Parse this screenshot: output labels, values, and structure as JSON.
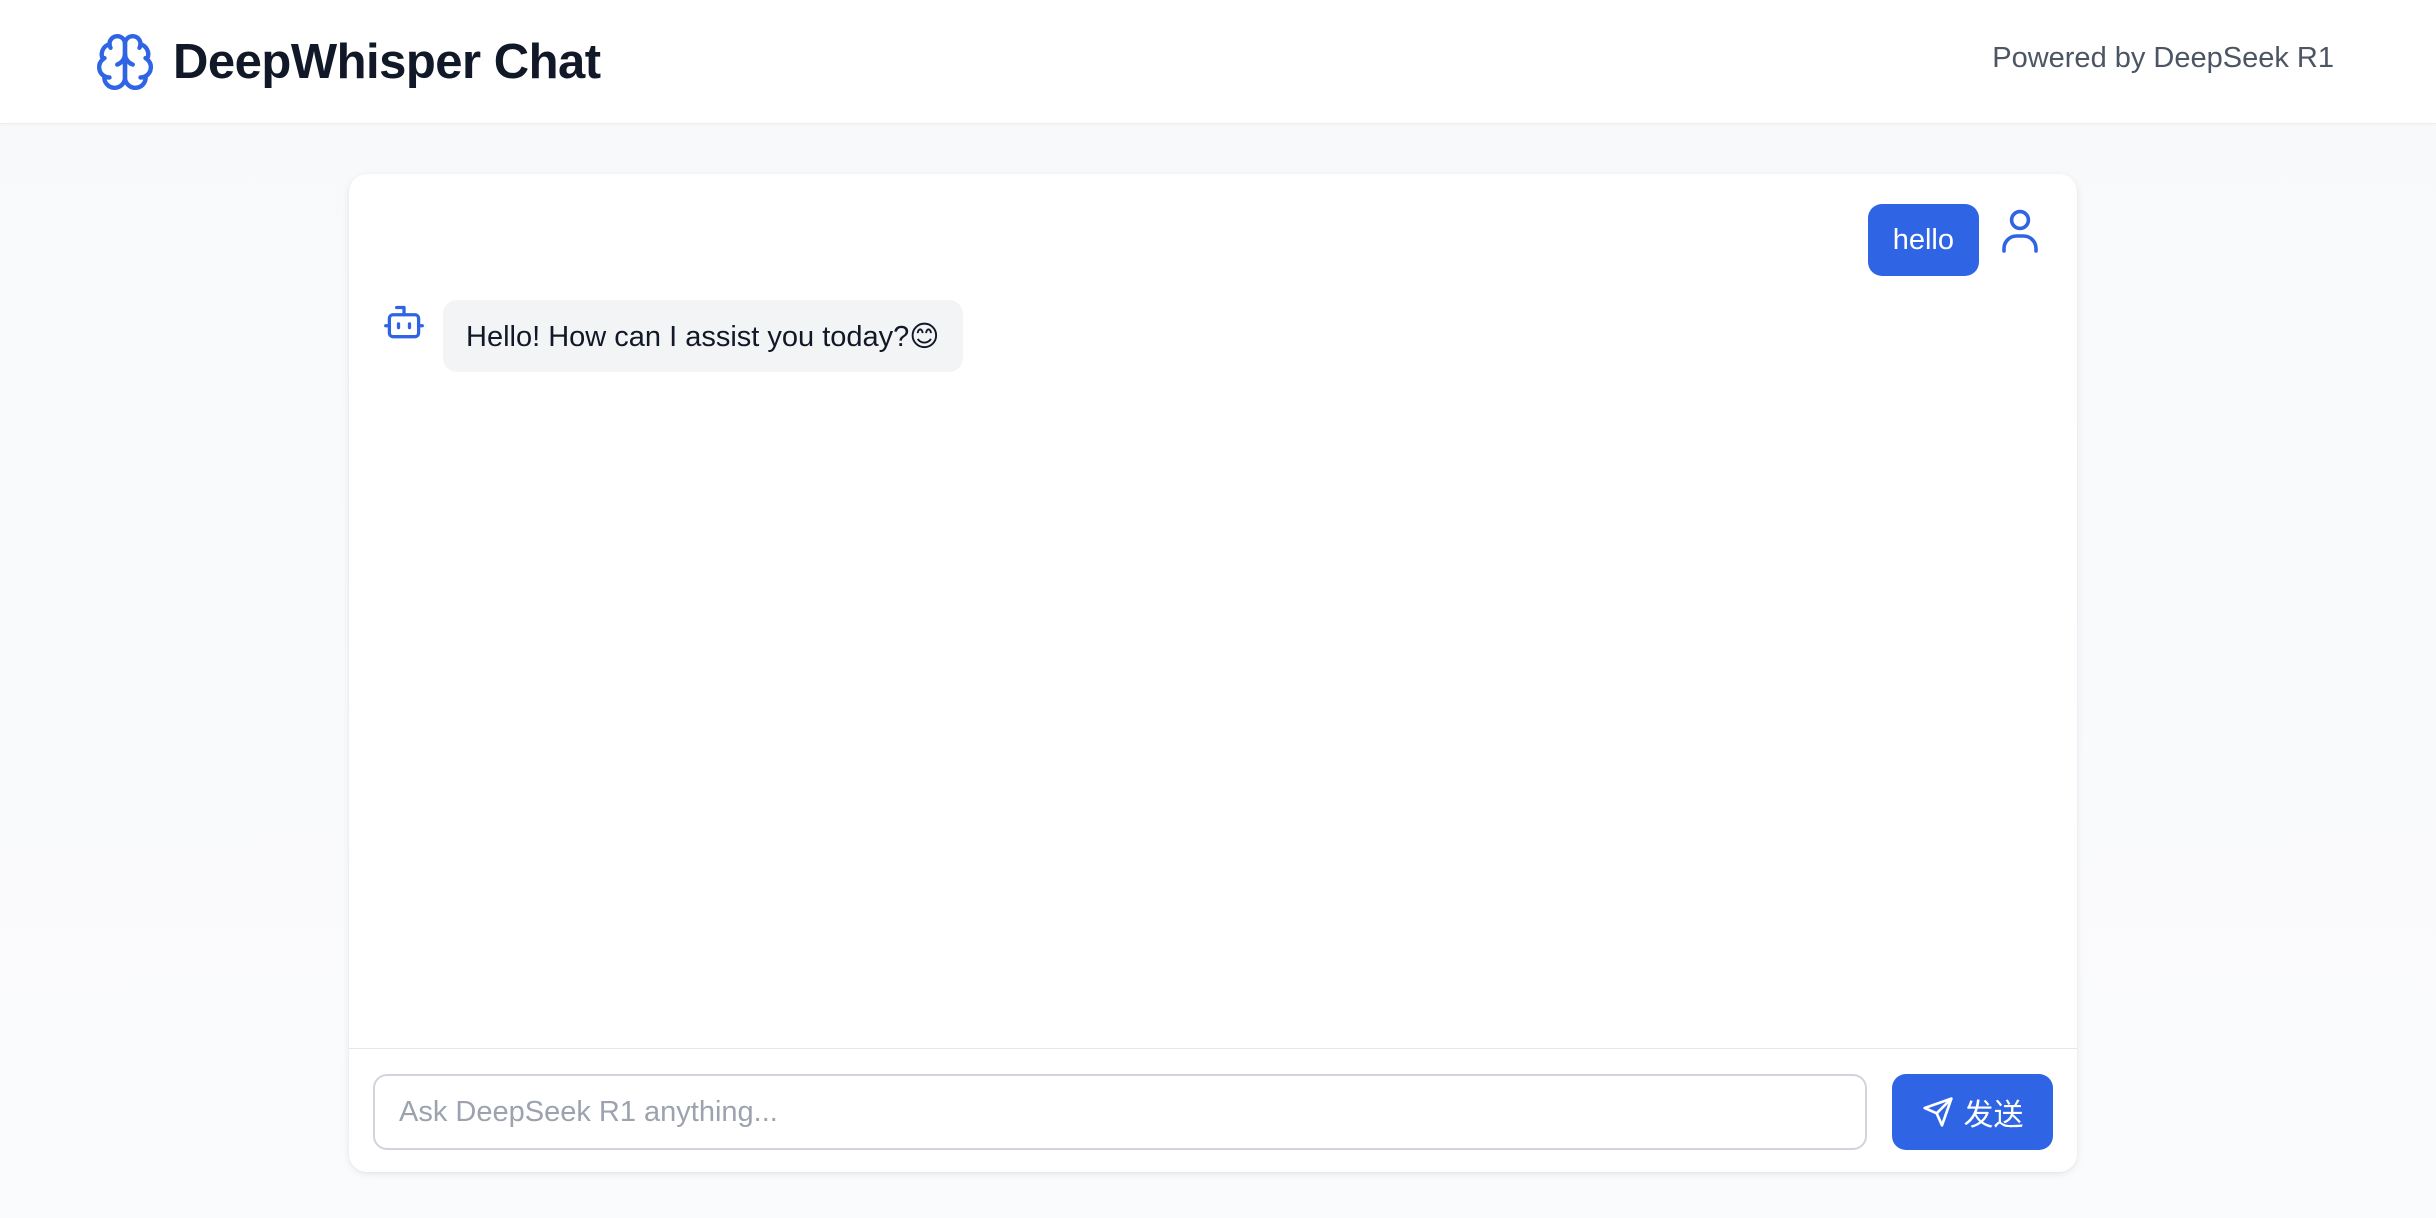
{
  "header": {
    "title": "DeepWhisper Chat",
    "powered_by": "Powered by DeepSeek R1",
    "logo_icon": "brain-icon"
  },
  "theme": {
    "accent": "#2f65e4",
    "bot_bubble": "#f3f4f6",
    "text": "#111827",
    "muted": "#4b5563"
  },
  "messages": [
    {
      "role": "user",
      "text": "hello",
      "avatar_icon": "user-icon"
    },
    {
      "role": "assistant",
      "text": "Hello! How can I assist you today?😊",
      "avatar_icon": "robot-icon"
    }
  ],
  "composer": {
    "value": "",
    "placeholder": "Ask DeepSeek R1 anything...",
    "send_label": "发送",
    "send_icon": "send-icon"
  }
}
